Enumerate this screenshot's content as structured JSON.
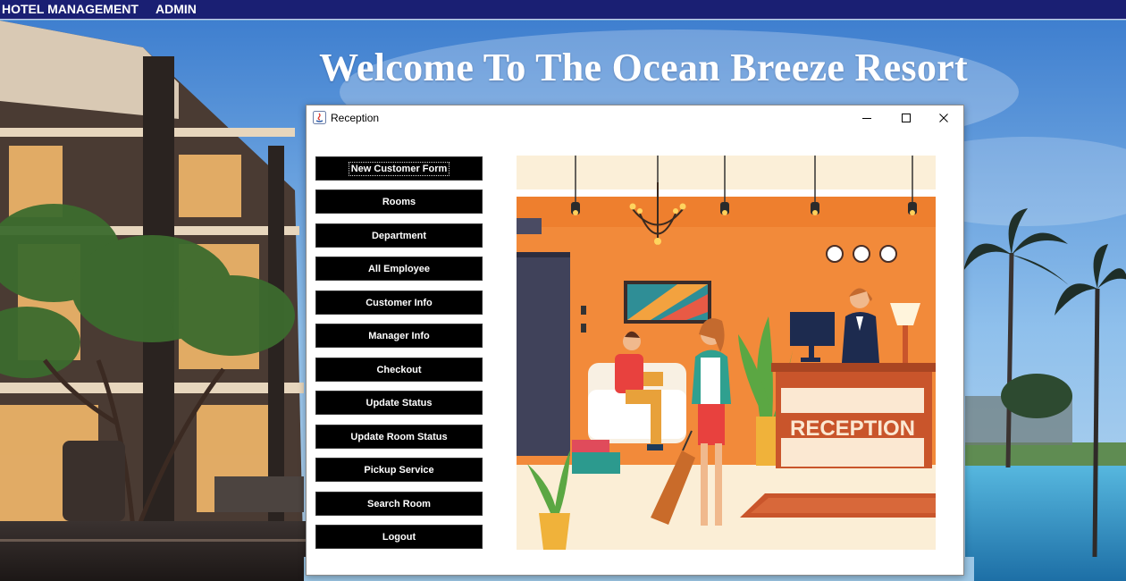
{
  "menubar": {
    "items": [
      "HOTEL MANAGEMENT",
      "ADMIN"
    ]
  },
  "header": {
    "welcome_text": "Welcome To The Ocean Breeze Resort"
  },
  "window": {
    "title": "Reception",
    "controls": [
      "minimize-icon",
      "maximize-icon",
      "close-icon"
    ]
  },
  "sidebar": {
    "buttons": [
      "New Customer Form",
      "Rooms",
      "Department",
      "All Employee",
      "Customer Info",
      "Manager Info",
      "Checkout",
      "Update Status",
      "Update Room Status",
      "Pickup Service",
      "Search Room",
      "Logout"
    ],
    "focused_index": 0
  },
  "illustration": {
    "desk_sign": "RECEPTION"
  },
  "colors": {
    "menubar_bg": "#1a1f73",
    "button_bg": "#000000",
    "button_text": "#ffffff",
    "wall_orange": "#f28a3a"
  }
}
